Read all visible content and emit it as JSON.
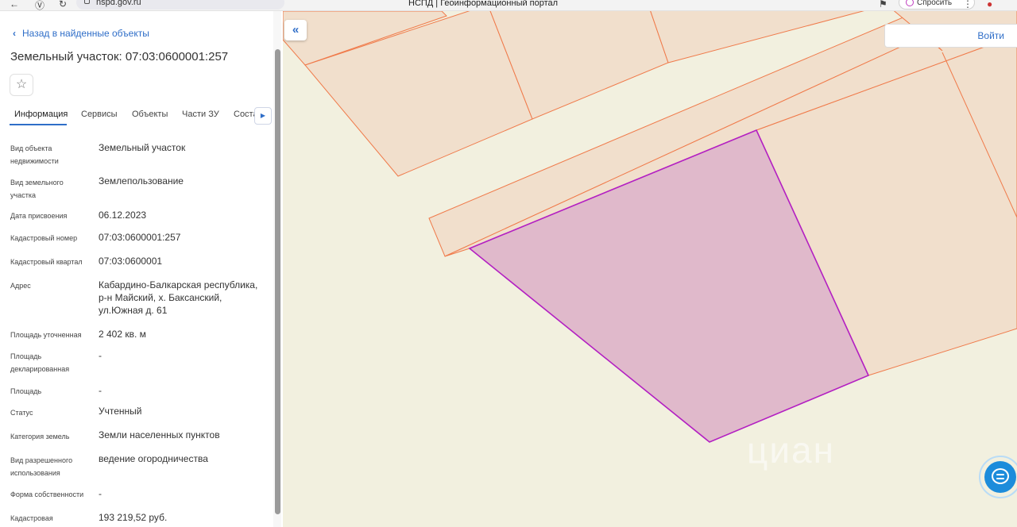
{
  "browser": {
    "url": "nspd.gov.ru",
    "tab_title": "НСПД | Геоинформационный портал",
    "ask_label": "Спросить"
  },
  "panel": {
    "back_label": "Назад в найденные объекты",
    "title": "Земельный участок: 07:03:0600001:257",
    "tabs": [
      "Информация",
      "Сервисы",
      "Объекты",
      "Части ЗУ",
      "Соста"
    ],
    "rows": [
      {
        "label": "Вид объекта недвижимости",
        "value": "Земельный участок"
      },
      {
        "label": "Вид земельного участка",
        "value": "Землепользование"
      },
      {
        "label": "Дата присвоения",
        "value": "06.12.2023"
      },
      {
        "label": "Кадастровый номер",
        "value": "07:03:0600001:257"
      },
      {
        "label": "Кадастровый квартал",
        "value": "07:03:0600001"
      },
      {
        "label": "Адрес",
        "value": "Кабардино-Балкарская республика, р-н Майский, х. Баксанский, ул.Южная д. 61"
      },
      {
        "label": "Площадь уточненная",
        "value": "2 402 кв. м"
      },
      {
        "label": "Площадь декларированная",
        "value": "-"
      },
      {
        "label": "Площадь",
        "value": "-"
      },
      {
        "label": "Статус",
        "value": "Учтенный"
      },
      {
        "label": "Категория земель",
        "value": "Земли населенных пунктов"
      },
      {
        "label": "Вид разрешенного использования",
        "value": "ведение огородничества"
      },
      {
        "label": "Форма собственности",
        "value": "-"
      },
      {
        "label": "Кадастровая",
        "value": "193 219,52 руб."
      }
    ]
  },
  "map": {
    "login_label": "Войти",
    "watermark": "циан",
    "colors": {
      "background": "#f2f0df",
      "parcel_fill": "#f1dfcc",
      "parcel_stroke": "#f07a4a",
      "selected_fill": "#e0b9cb",
      "selected_stroke": "#b31fc2"
    }
  },
  "icons": {
    "back": "chevron-left-icon",
    "star": "star-icon",
    "collapse": "double-chevron-left-icon",
    "tabs_next": "triangle-right-icon",
    "chat": "chat-bubble-icon"
  }
}
